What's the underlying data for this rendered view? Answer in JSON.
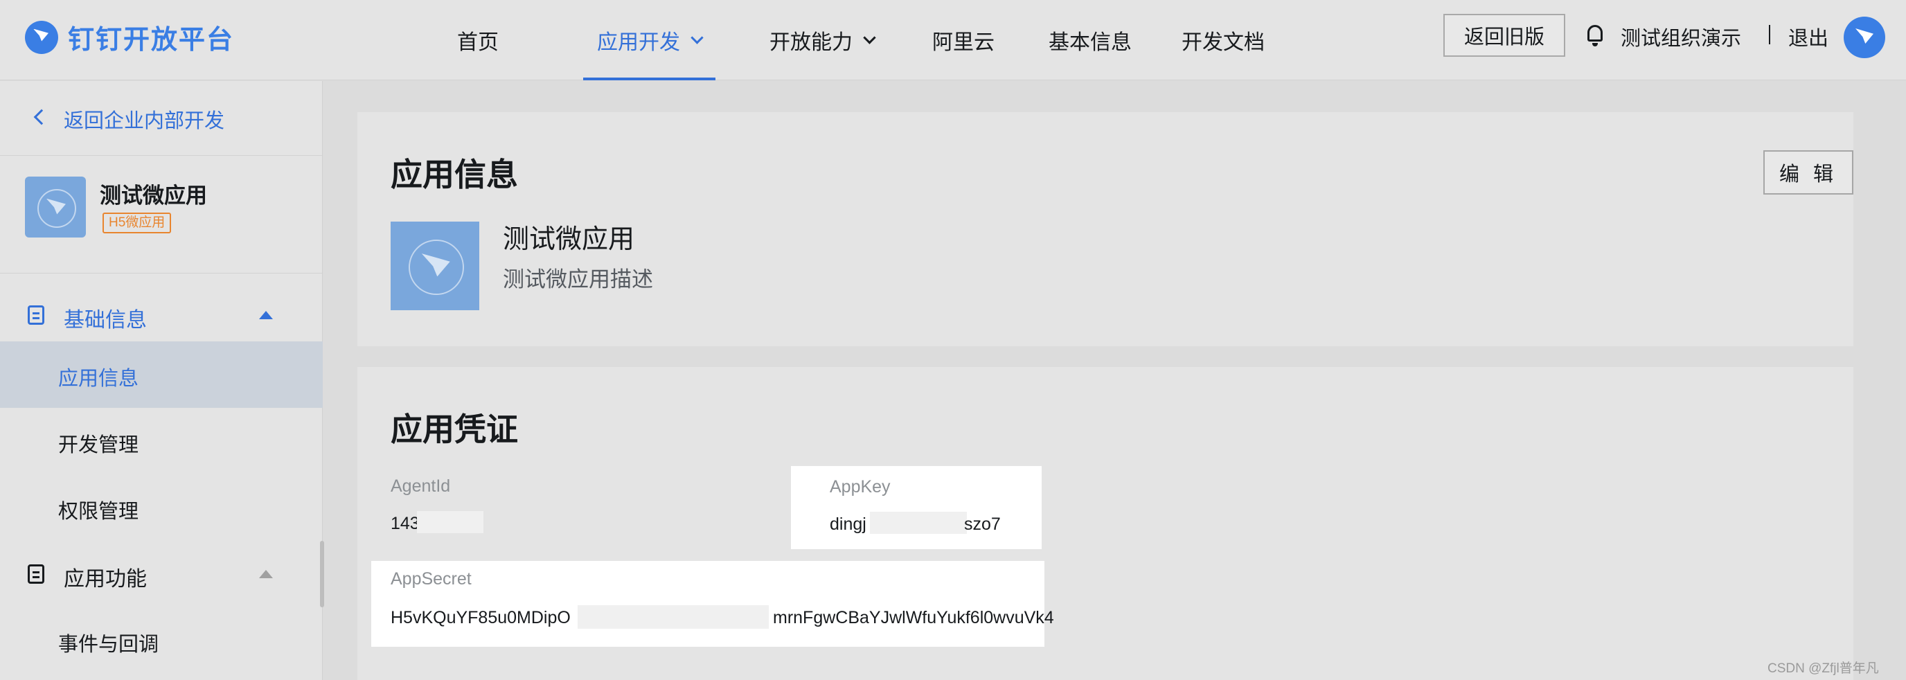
{
  "header": {
    "logo_text": "钉钉开放平台",
    "nav": [
      {
        "label": "首页"
      },
      {
        "label": "应用开发"
      },
      {
        "label": "开放能力"
      },
      {
        "label": "阿里云"
      },
      {
        "label": "基本信息"
      },
      {
        "label": "开发文档"
      }
    ],
    "old_version_label": "返回旧版",
    "org_name": "测试组织演示",
    "separator": "|",
    "logout_label": "退出"
  },
  "sidebar": {
    "back_label": "返回企业内部开发",
    "app_name": "测试微应用",
    "app_tag": "H5微应用",
    "groups": [
      {
        "label": "基础信息",
        "items": [
          "应用信息",
          "开发管理",
          "权限管理"
        ]
      },
      {
        "label": "应用功能",
        "items": [
          "事件与回调"
        ]
      }
    ]
  },
  "app_info": {
    "title": "应用信息",
    "edit_label": "编 辑",
    "app_name": "测试微应用",
    "app_desc": "测试微应用描述"
  },
  "credentials": {
    "title": "应用凭证",
    "agent_id_label": "AgentId",
    "agent_id_value": "143",
    "app_key_label": "AppKey",
    "app_key_prefix": "dingj",
    "app_key_suffix": "szo7",
    "app_secret_label": "AppSecret",
    "app_secret_prefix": "H5vKQuYF85u0MDipO",
    "app_secret_suffix": "mrnFgwCBaYJwlWfuYukf6l0wvuVk4"
  },
  "watermark": "CSDN @Zfjl普年凡",
  "colors": {
    "accent": "#3370d8",
    "tag": "#e8852f"
  }
}
